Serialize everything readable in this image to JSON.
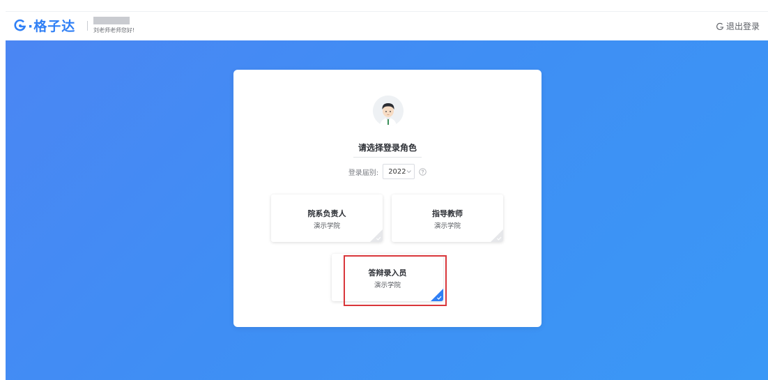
{
  "header": {
    "logo_text": "·格子达",
    "greeting": "刘老师老师您好!",
    "logout_label": "退出登录"
  },
  "login": {
    "title": "请选择登录角色",
    "year_label": "登录届别:",
    "year_value": "2022"
  },
  "roles": [
    {
      "name": "院系负责人",
      "college": "演示学院",
      "selected": false
    },
    {
      "name": "指导教师",
      "college": "演示学院",
      "selected": false
    },
    {
      "name": "答辩录入员",
      "college": "演示学院",
      "selected": true
    }
  ],
  "colors": {
    "brand": "#2f7ff5",
    "background": "#4289f4",
    "highlight": "#d9363a"
  }
}
